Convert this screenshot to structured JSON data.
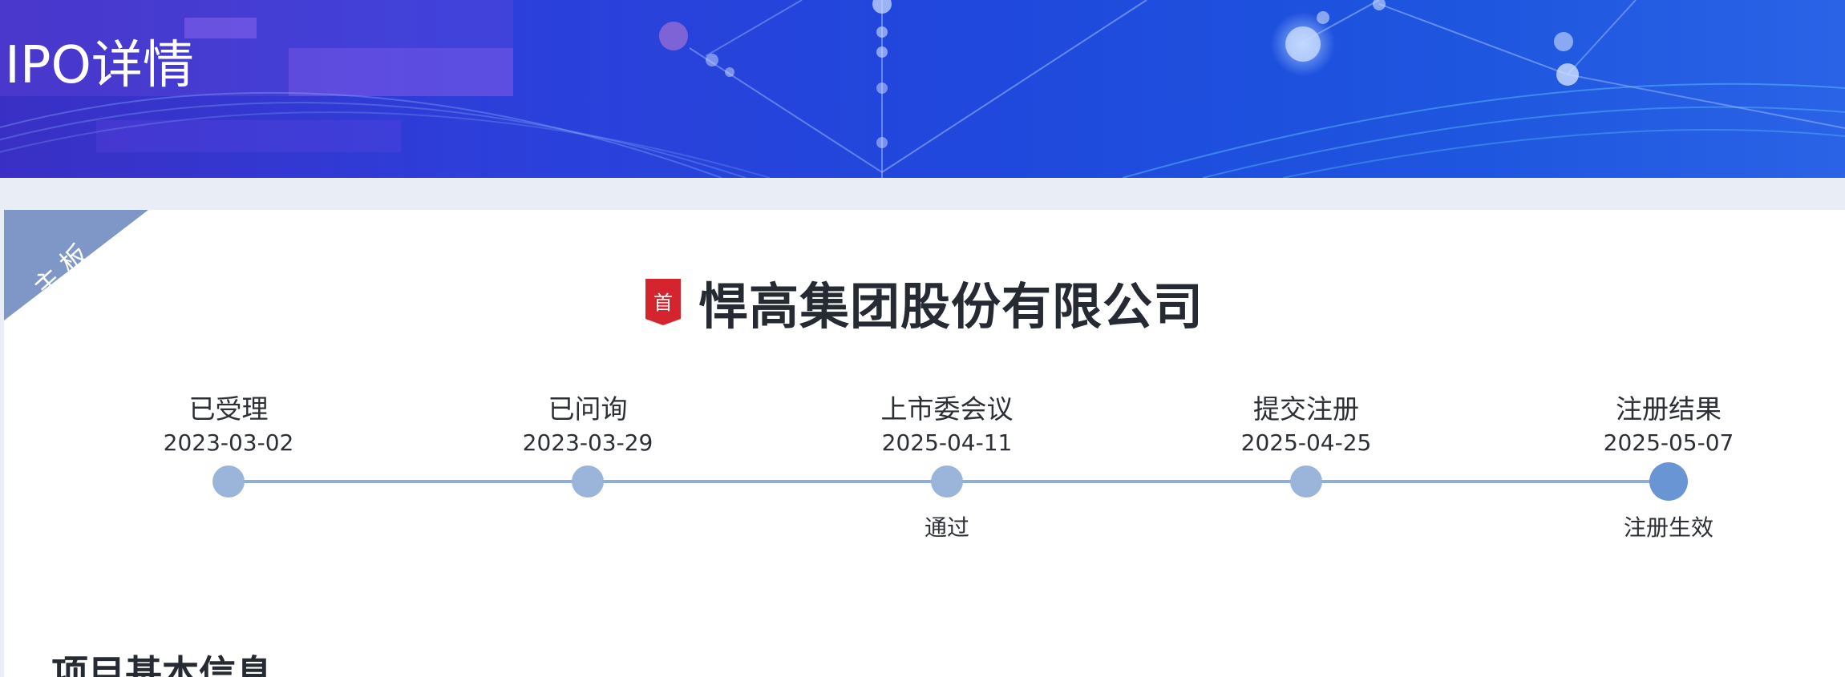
{
  "header": {
    "title": "IPO详情"
  },
  "board": {
    "label": "主板",
    "ribbon_color": "#7f97c6"
  },
  "company": {
    "badge": "首",
    "badge_color": "#d4242e",
    "name": "悍高集团股份有限公司"
  },
  "timeline": {
    "steps": [
      {
        "label": "已受理",
        "date": "2023-03-02",
        "note": ""
      },
      {
        "label": "已问询",
        "date": "2023-03-29",
        "note": ""
      },
      {
        "label": "上市委会议",
        "date": "2025-04-11",
        "note": "通过"
      },
      {
        "label": "提交注册",
        "date": "2025-04-25",
        "note": ""
      },
      {
        "label": "注册结果",
        "date": "2025-05-07",
        "note": "注册生效"
      }
    ],
    "current_step": 4,
    "line_color": "#8fb0d3",
    "dot_color": "#9ab5d9",
    "current_dot_color": "#6a95d4"
  },
  "sections": {
    "basic_info_title": "项目基本信息"
  }
}
